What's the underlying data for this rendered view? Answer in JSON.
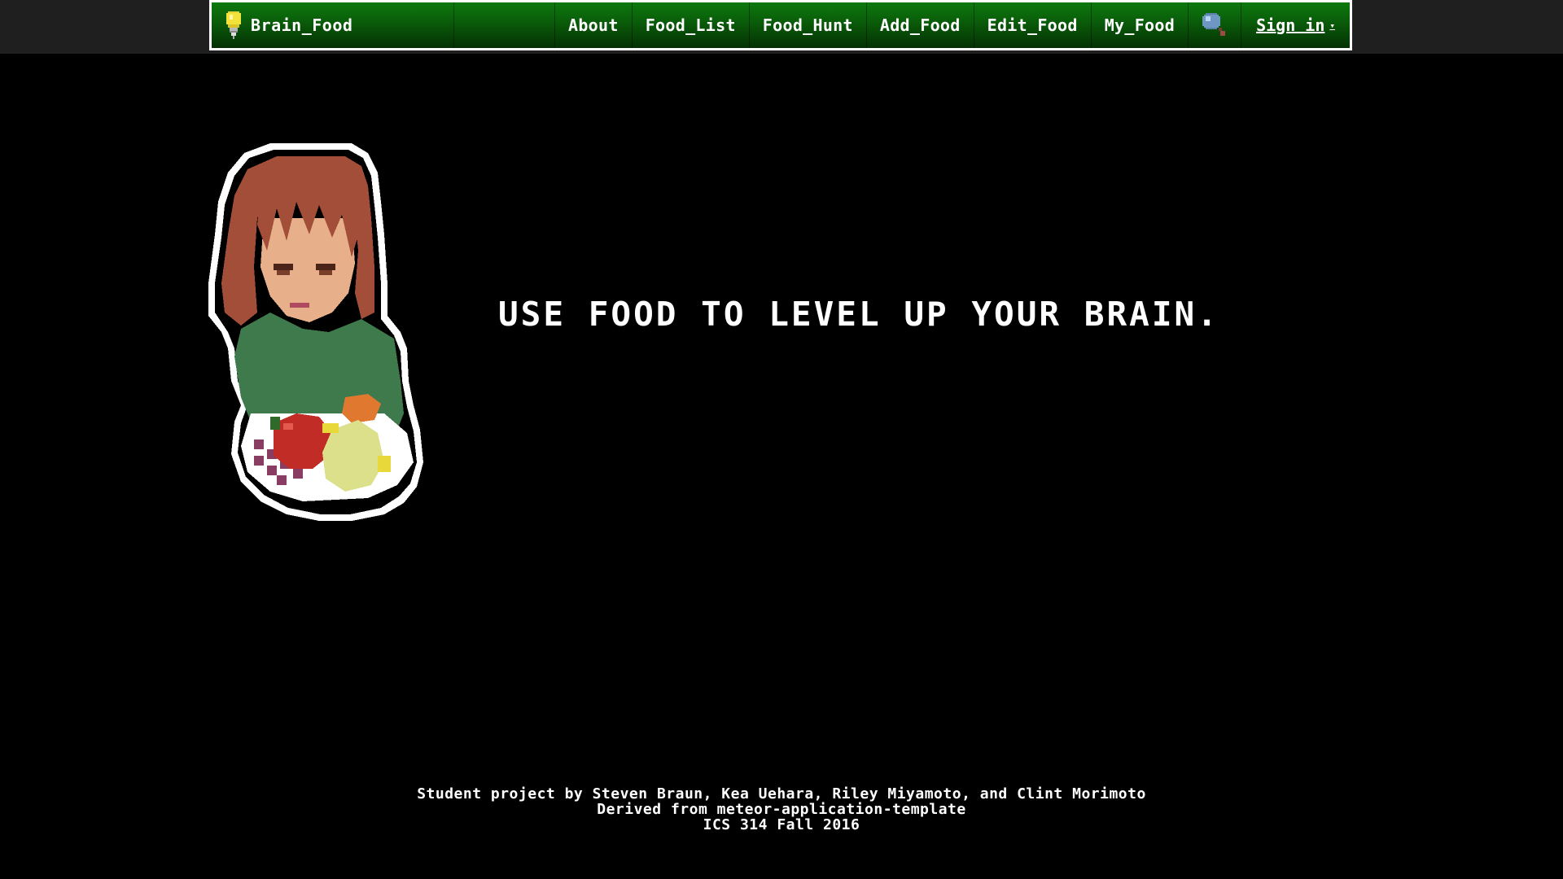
{
  "navbar": {
    "brand": "Brain_Food",
    "items": [
      {
        "label": "About"
      },
      {
        "label": "Food_List"
      },
      {
        "label": "Food_Hunt"
      },
      {
        "label": "Add_Food"
      },
      {
        "label": "Edit_Food"
      },
      {
        "label": "My_Food"
      }
    ],
    "search_icon": "magnifier-icon",
    "signin_label": "Sign in",
    "signin_caret": "▾",
    "colors": {
      "bar_top": "#0d7a0d",
      "bar_bottom": "#043104",
      "border": "#ffffff"
    }
  },
  "hero": {
    "tagline": "USE FOOD TO LEVEL UP YOUR BRAIN.",
    "image": "pixel-art-girl-with-fruit-bowl"
  },
  "footer": {
    "line1": "Student project by Steven Braun, Kea Uehara, Riley Miyamoto, and Clint Morimoto",
    "line2": "Derived from meteor-application-template",
    "line3": "ICS 314 Fall 2016"
  },
  "colors": {
    "background": "#000000",
    "text": "#ffffff",
    "header_strip": "#1f1f1f"
  }
}
